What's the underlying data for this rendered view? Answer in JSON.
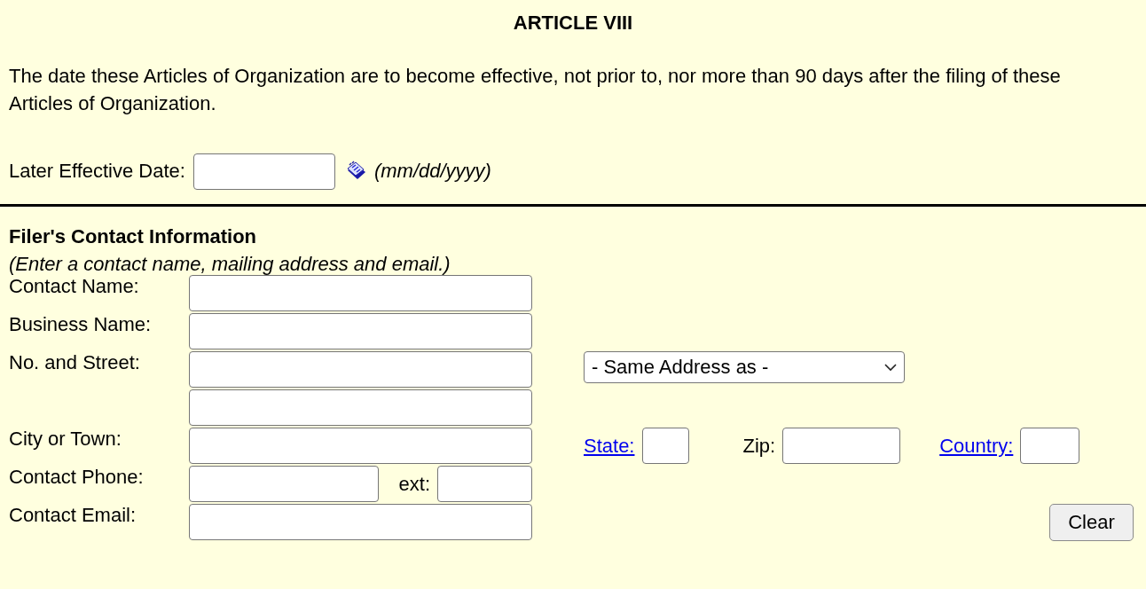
{
  "article_title": "ARTICLE VIII",
  "description": "The date these Articles of Organization are to become effective, not prior to, nor more than 90 days after the filing of these Articles of Organization.",
  "effective_date": {
    "label": "Later Effective Date:",
    "format_hint": "(mm/dd/yyyy)"
  },
  "contact": {
    "heading": "Filer's Contact Information",
    "instructions": "(Enter a contact name, mailing address and email.)",
    "contact_name_label": "Contact Name:",
    "business_name_label": "Business Name:",
    "street_label": "No. and Street:",
    "same_address_dropdown": "- Same Address as -",
    "city_label": "City or Town:",
    "state_link": "State:",
    "zip_label": "Zip:",
    "country_link": "Country:",
    "phone_label": "Contact Phone:",
    "ext_label": "ext:",
    "email_label": "Contact Email:",
    "clear_button": "Clear"
  }
}
